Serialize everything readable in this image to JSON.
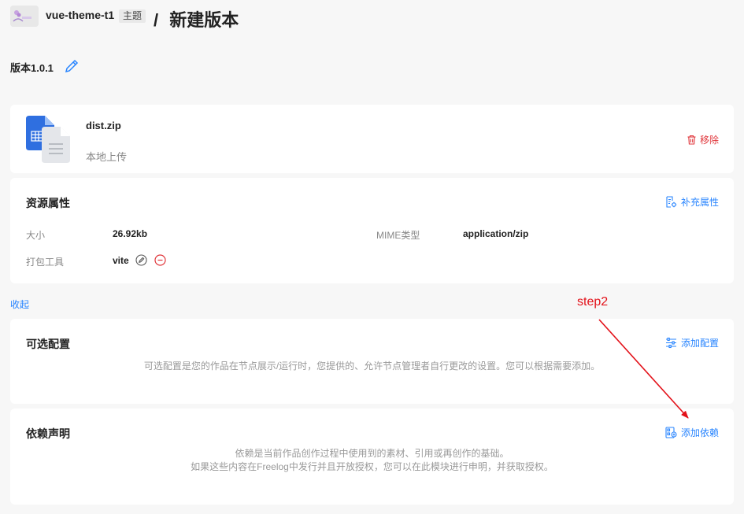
{
  "header": {
    "project_name": "vue-theme-t1",
    "tag": "主题",
    "separator": "/",
    "title": "新建版本"
  },
  "version": {
    "label": "版本1.0.1"
  },
  "file": {
    "name": "dist.zip",
    "source": "本地上传",
    "remove_label": "移除"
  },
  "resource_props": {
    "title": "资源属性",
    "action_label": "补充属性",
    "size_label": "大小",
    "size_value": "26.92kb",
    "mime_label": "MIME类型",
    "mime_value": "application/zip",
    "tool_label": "打包工具",
    "tool_value": "vite"
  },
  "collapse_label": "收起",
  "optional_config": {
    "title": "可选配置",
    "action_label": "添加配置",
    "description": "可选配置是您的作品在节点展示/运行时，您提供的、允许节点管理者自行更改的设置。您可以根据需要添加。"
  },
  "dependencies": {
    "title": "依赖声明",
    "action_label": "添加依赖",
    "description_line1": "依赖是当前作品创作过程中使用到的素材、引用或再创作的基础。",
    "description_line2": "如果这些内容在Freelog中发行并且开放授权，您可以在此模块进行申明，并获取授权。"
  },
  "annotation": {
    "label": "step2",
    "color": "#e3121a"
  },
  "colors": {
    "accent": "#2784ff",
    "danger": "#e0363b"
  }
}
